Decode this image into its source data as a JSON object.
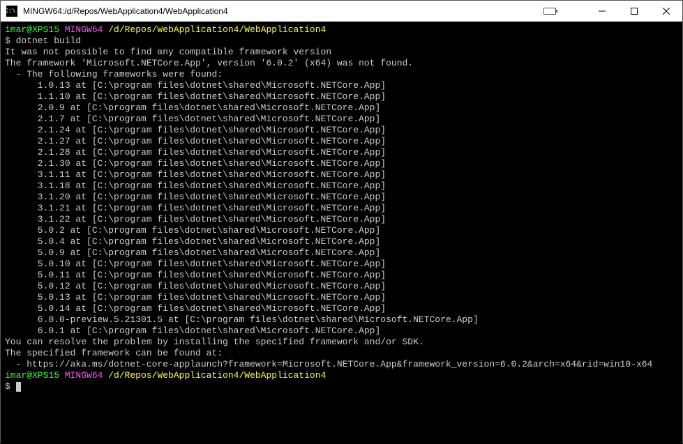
{
  "titlebar": {
    "title": "MINGW64:/d/Repos/WebApplication4/WebApplication4",
    "icon_text": "C:\\."
  },
  "prompt": {
    "user": "imar@XPS15",
    "env": "MINGW64",
    "path": "/d/Repos/WebApplication4/WebApplication4",
    "symbol": "$"
  },
  "command": "dotnet build",
  "output": {
    "line1": "It was not possible to find any compatible framework version",
    "line2": "The framework 'Microsoft.NETCore.App', version '6.0.2' (x64) was not found.",
    "line3": "  - The following frameworks were found:",
    "frameworks": [
      "      1.0.13 at [C:\\program files\\dotnet\\shared\\Microsoft.NETCore.App]",
      "      1.1.10 at [C:\\program files\\dotnet\\shared\\Microsoft.NETCore.App]",
      "      2.0.9 at [C:\\program files\\dotnet\\shared\\Microsoft.NETCore.App]",
      "      2.1.7 at [C:\\program files\\dotnet\\shared\\Microsoft.NETCore.App]",
      "      2.1.24 at [C:\\program files\\dotnet\\shared\\Microsoft.NETCore.App]",
      "      2.1.27 at [C:\\program files\\dotnet\\shared\\Microsoft.NETCore.App]",
      "      2.1.28 at [C:\\program files\\dotnet\\shared\\Microsoft.NETCore.App]",
      "      2.1.30 at [C:\\program files\\dotnet\\shared\\Microsoft.NETCore.App]",
      "      3.1.11 at [C:\\program files\\dotnet\\shared\\Microsoft.NETCore.App]",
      "      3.1.18 at [C:\\program files\\dotnet\\shared\\Microsoft.NETCore.App]",
      "      3.1.20 at [C:\\program files\\dotnet\\shared\\Microsoft.NETCore.App]",
      "      3.1.21 at [C:\\program files\\dotnet\\shared\\Microsoft.NETCore.App]",
      "      3.1.22 at [C:\\program files\\dotnet\\shared\\Microsoft.NETCore.App]",
      "      5.0.2 at [C:\\program files\\dotnet\\shared\\Microsoft.NETCore.App]",
      "      5.0.4 at [C:\\program files\\dotnet\\shared\\Microsoft.NETCore.App]",
      "      5.0.9 at [C:\\program files\\dotnet\\shared\\Microsoft.NETCore.App]",
      "      5.0.10 at [C:\\program files\\dotnet\\shared\\Microsoft.NETCore.App]",
      "      5.0.11 at [C:\\program files\\dotnet\\shared\\Microsoft.NETCore.App]",
      "      5.0.12 at [C:\\program files\\dotnet\\shared\\Microsoft.NETCore.App]",
      "      5.0.13 at [C:\\program files\\dotnet\\shared\\Microsoft.NETCore.App]",
      "      5.0.14 at [C:\\program files\\dotnet\\shared\\Microsoft.NETCore.App]",
      "      6.0.0-preview.5.21301.5 at [C:\\program files\\dotnet\\shared\\Microsoft.NETCore.App]",
      "      6.0.1 at [C:\\program files\\dotnet\\shared\\Microsoft.NETCore.App]"
    ],
    "resolve": "You can resolve the problem by installing the specified framework and/or SDK.",
    "found_at": "The specified framework can be found at:",
    "url_line": "  - https://aka.ms/dotnet-core-applaunch?framework=Microsoft.NETCore.App&framework_version=6.0.2&arch=x64&rid=win10-x64"
  }
}
